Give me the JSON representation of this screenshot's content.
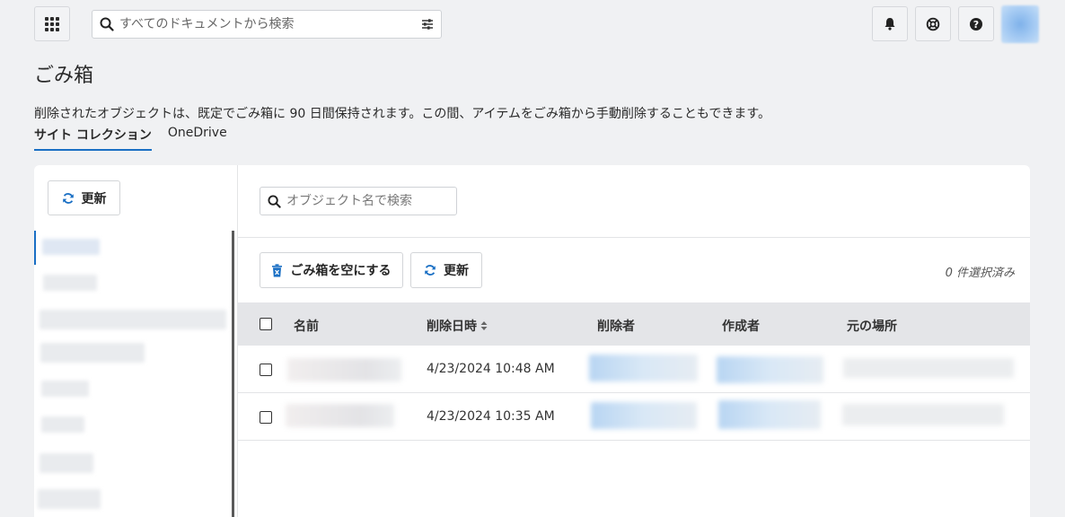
{
  "header": {
    "search_placeholder": "すべてのドキュメントから検索",
    "icons": [
      "apps-grid-icon",
      "search-icon",
      "filter-icon",
      "bell-icon",
      "lifebuoy-icon",
      "help-icon"
    ]
  },
  "page": {
    "title": "ごみ箱",
    "description": "削除されたオブジェクトは、既定でごみ箱に 90 日間保持されます。この間、アイテムをごみ箱から手動削除することもできます。"
  },
  "tabs": [
    {
      "label": "サイト コレクション",
      "active": true
    },
    {
      "label": "OneDrive",
      "active": false
    }
  ],
  "left_pane": {
    "refresh_label": "更新"
  },
  "right_pane": {
    "search_placeholder": "オブジェクト名で検索",
    "empty_bin_label": "ごみ箱を空にする",
    "refresh_label": "更新",
    "selected_count": "0 件選択済み",
    "columns": {
      "name": "名前",
      "deleted_date": "削除日時",
      "deleted_by": "削除者",
      "created_by": "作成者",
      "location": "元の場所"
    },
    "rows": [
      {
        "deleted_date": "4/23/2024 10:48 AM"
      },
      {
        "deleted_date": "4/23/2024 10:35 AM"
      }
    ]
  },
  "colors": {
    "accent": "#1a6fc4",
    "background": "#f0f1f3",
    "header_row": "#e4e5e8"
  }
}
